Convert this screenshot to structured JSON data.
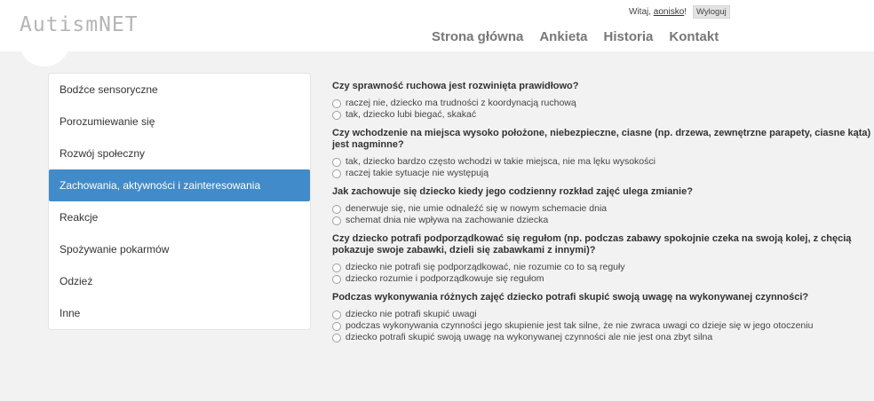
{
  "header": {
    "logo": "AutismNET",
    "greeting_prefix": "Witaj,",
    "username": "aonisko",
    "greeting_suffix": "!",
    "logout": "Wyloguj",
    "nav": [
      "Strona główna",
      "Ankieta",
      "Historia",
      "Kontakt"
    ]
  },
  "sidebar": {
    "active_index": 3,
    "items": [
      "Bodźce sensoryczne",
      "Porozumiewanie się",
      "Rozwój społeczny",
      "Zachowania, aktywności i zainteresowania",
      "Reakcje",
      "Spożywanie pokarmów",
      "Odzież",
      "Inne"
    ]
  },
  "questions": [
    {
      "text": "Czy sprawność ruchowa jest rozwinięta prawidłowo?",
      "options": [
        "raczej nie, dziecko ma trudności z koordynacją ruchową",
        "tak, dziecko lubi biegać, skakać"
      ]
    },
    {
      "text": "Czy wchodzenie na miejsca wysoko położone, niebezpieczne, ciasne (np. drzewa, zewnętrzne parapety, ciasne kąta) jest nagminne?",
      "options": [
        "tak, dziecko bardzo często wchodzi w takie miejsca, nie ma lęku wysokości",
        "raczej takie sytuacje nie występują"
      ]
    },
    {
      "text": "Jak zachowuje się dziecko kiedy jego codzienny rozkład zajęć ulega zmianie?",
      "options": [
        "denerwuje się, nie umie odnaleźć się w nowym schemacie dnia",
        "schemat dnia nie wpływa na zachowanie dziecka"
      ]
    },
    {
      "text": "Czy dziecko potrafi podporządkować się regułom (np. podczas zabawy spokojnie czeka na swoją kolej, z chęcią pokazuje swoje zabawki, dzieli się zabawkami z innymi)?",
      "options": [
        "dziecko nie potrafi się podporządkować, nie rozumie co to są reguły",
        "dziecko rozumie i podporządkowuje się regułom"
      ]
    },
    {
      "text": "Podczas wykonywania różnych zajęć dziecko potrafi skupić swoją uwagę na wykonywanej czynności?",
      "options": [
        "dziecko nie potrafi skupić uwagi",
        "podczas wykonywania czynności jego skupienie jest tak silne, że nie zwraca uwagi co dzieje się w jego otoczeniu",
        "dziecko potrafi skupić swoją uwagę na wykonywanej czynności ale nie jest ona zbyt silna"
      ]
    }
  ]
}
